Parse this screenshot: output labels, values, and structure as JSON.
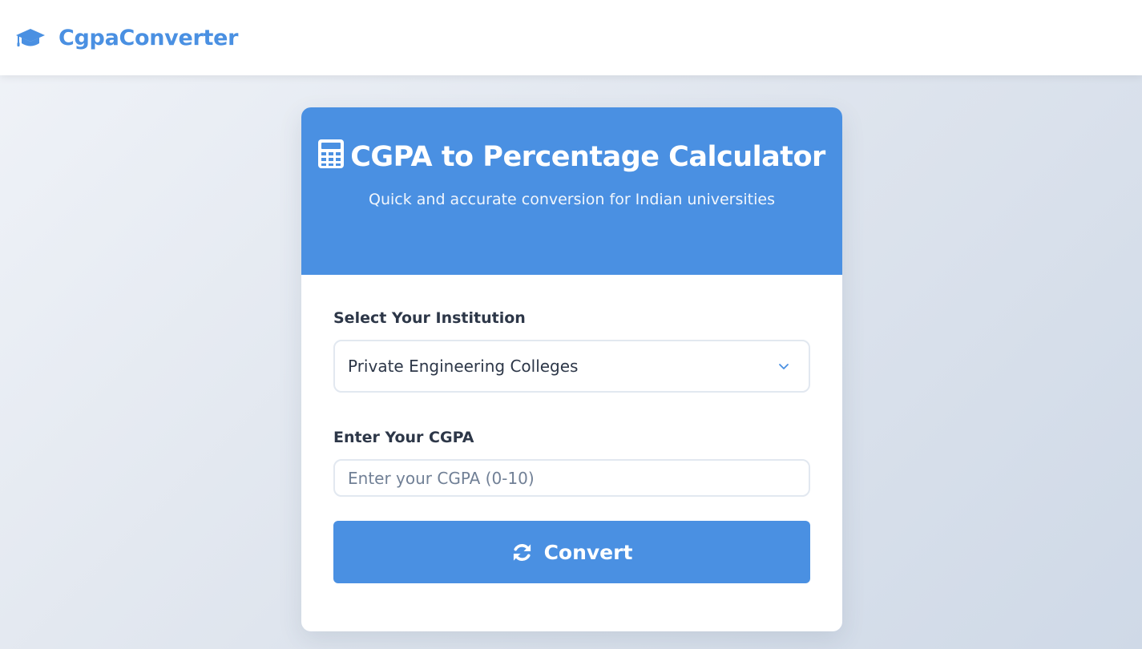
{
  "navbar": {
    "brand_name": "CgpaConverter",
    "brand_icon": "graduation-cap-icon"
  },
  "card": {
    "header": {
      "icon": "calculator-icon",
      "title": "CGPA to Percentage Calculator",
      "subtitle": "Quick and accurate conversion for Indian universities"
    },
    "institution": {
      "label": "Select Your Institution",
      "selected": "Private Engineering Colleges",
      "icon": "chevron-down-icon"
    },
    "cgpa": {
      "label": "Enter Your CGPA",
      "value": "",
      "placeholder": "Enter your CGPA (0-10)"
    },
    "convert_button": {
      "label": "Convert",
      "icon": "sync-icon"
    }
  },
  "colors": {
    "accent": "#4a90e2",
    "text": "#2d3748",
    "border": "#e2e8f0",
    "background_start": "#f0f3f8",
    "background_end": "#cfd9e7"
  }
}
